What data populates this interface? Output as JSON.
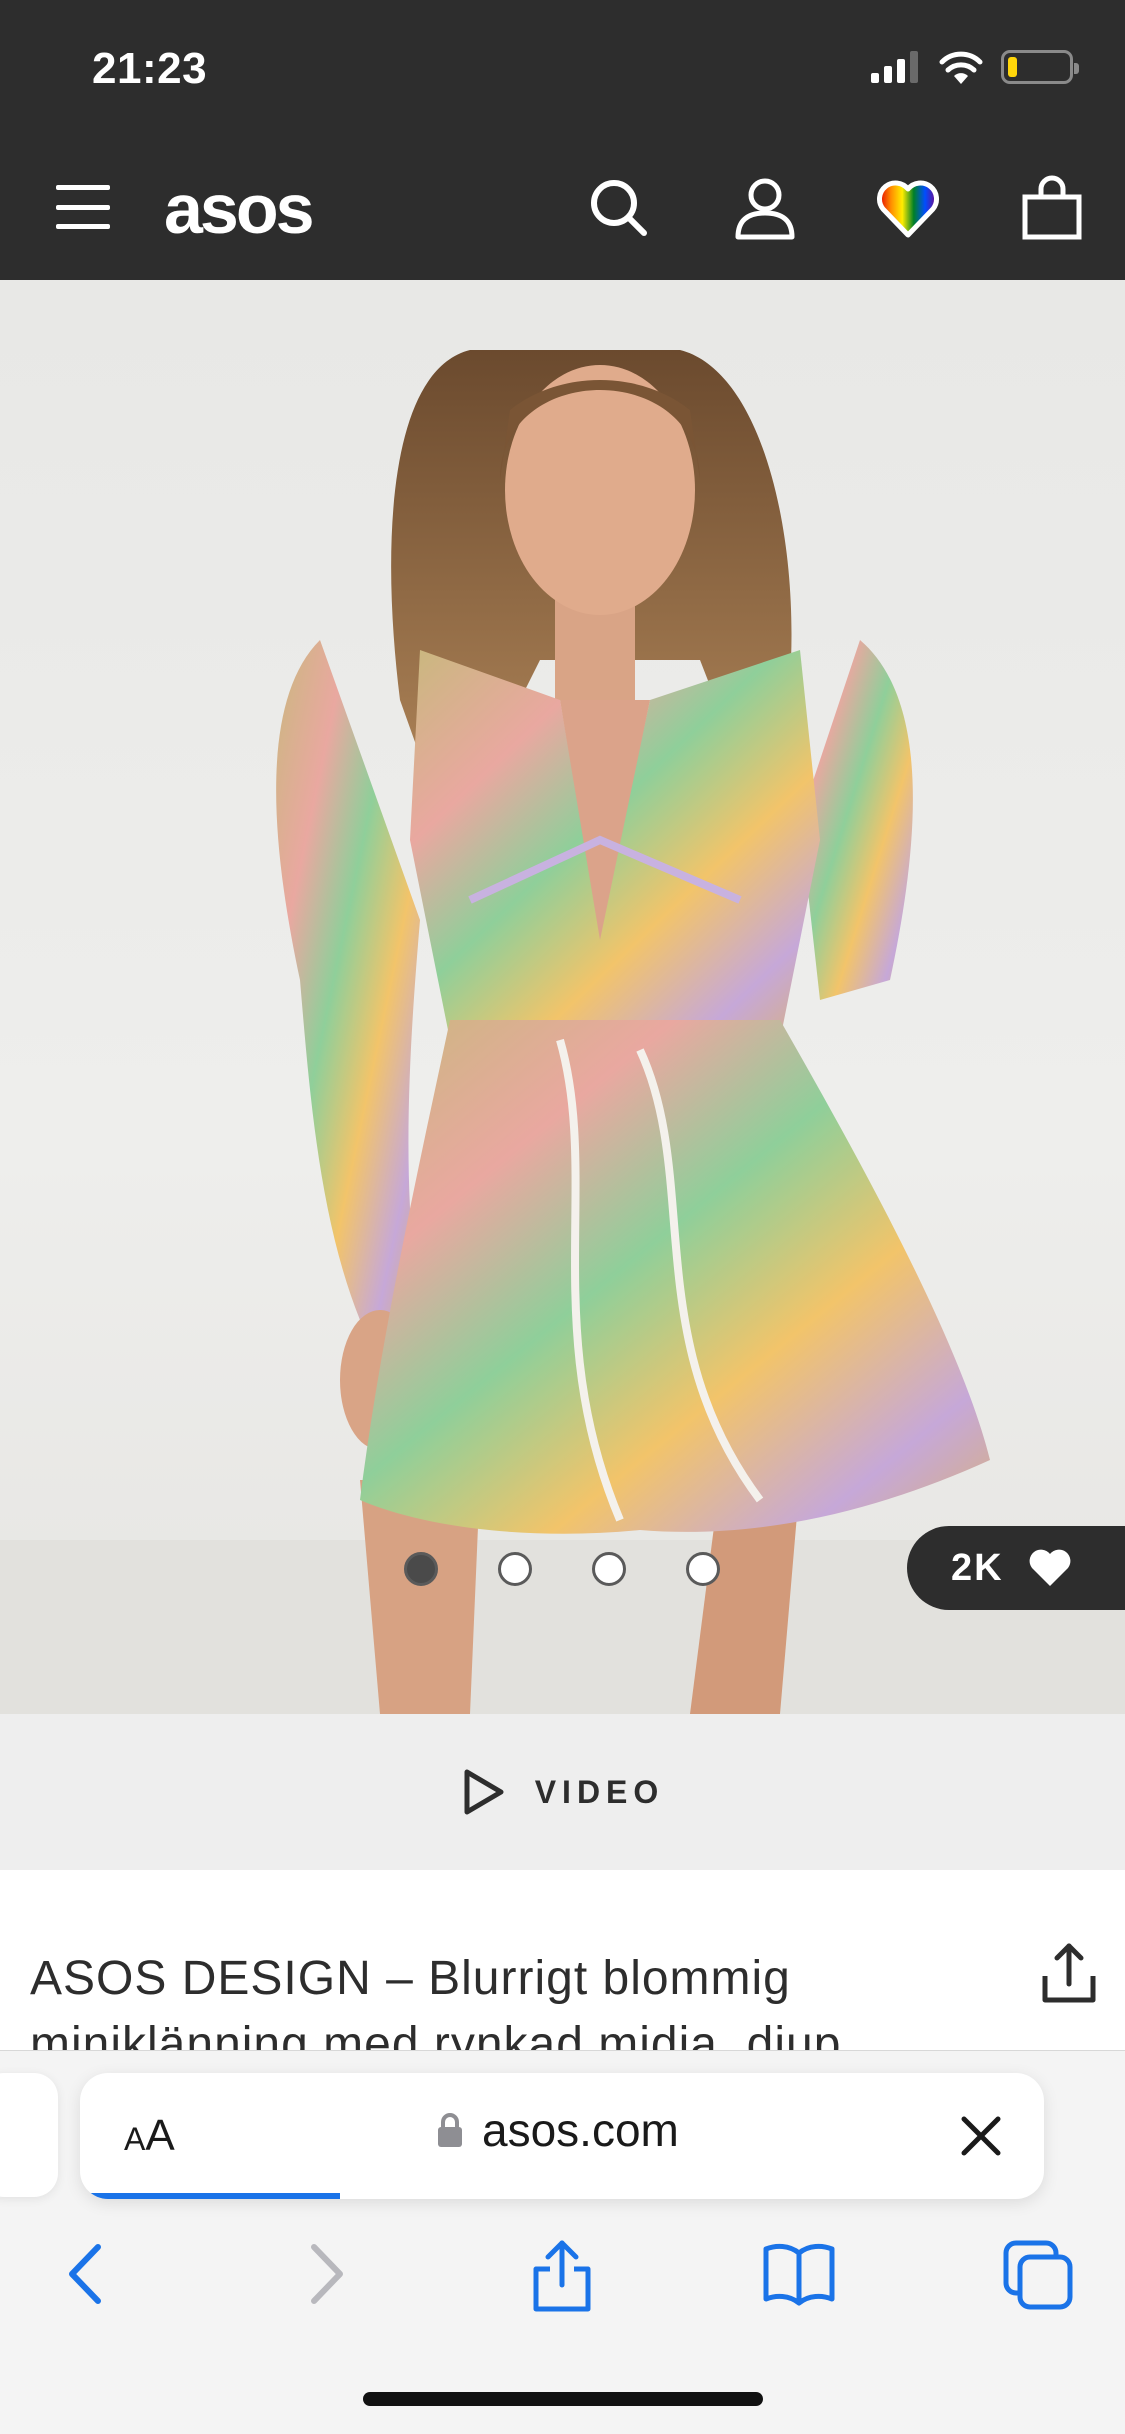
{
  "status_bar": {
    "time": "21:23",
    "battery_color": "#ffd60a"
  },
  "header": {
    "logo": "asos",
    "icons": [
      "menu-icon",
      "search-icon",
      "account-icon",
      "saved-items-heart-icon",
      "bag-icon"
    ]
  },
  "hero": {
    "image": "product-photo-floral-mini-dress",
    "carousel": {
      "count": 4,
      "active_index": 0
    },
    "likes": "2K"
  },
  "video": {
    "label": "VIDEO"
  },
  "product": {
    "title": "ASOS DESIGN – Blurrigt blommig miniklänning med rynkad midja, djup"
  },
  "browser": {
    "text_size_label_small": "A",
    "text_size_label_large": "A",
    "url": "asos.com",
    "load_progress": 0.27,
    "accent": "#1a73e8"
  }
}
